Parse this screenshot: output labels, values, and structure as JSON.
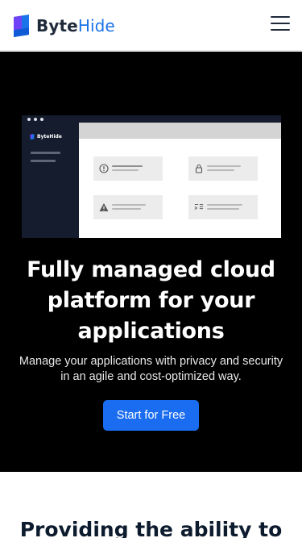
{
  "header": {
    "brand_part1": "Byte",
    "brand_part2": "Hide",
    "menu_icon": "hamburger-menu-icon",
    "brand_color": "#1a73e8"
  },
  "hero": {
    "background": "#000000",
    "mockup": {
      "brand": "ByteHide",
      "cards": [
        {
          "icon": "info-icon"
        },
        {
          "icon": "lock-icon"
        },
        {
          "icon": "warning-icon"
        },
        {
          "icon": "code-icon"
        }
      ]
    },
    "title_line1": "Fully managed cloud",
    "title_line2": "platform for your",
    "title_line3": "applications",
    "subtitle_line1": "Manage your applications with privacy and security",
    "subtitle_line2": "in an agile and cost-optimized way.",
    "cta_label": "Start for Free",
    "cta_color": "#1a6cf0"
  },
  "next_section": {
    "title": "Providing the ability to"
  }
}
